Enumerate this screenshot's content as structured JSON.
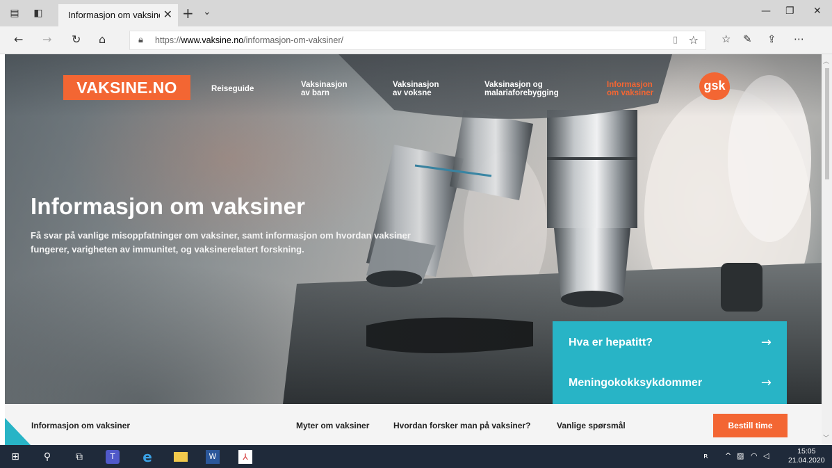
{
  "browser": {
    "tab_title": "Informasjon om vaksine",
    "url_prefix": "https://",
    "url_domain": "www.vaksine.no",
    "url_path": "/informasjon-om-vaksiner/"
  },
  "site": {
    "logo": "VAKSINE.NO",
    "nav": [
      {
        "line1": "Reiseguide",
        "line2": ""
      },
      {
        "line1": "Vaksinasjon",
        "line2": "av barn"
      },
      {
        "line1": "Vaksinasjon",
        "line2": "av voksne"
      },
      {
        "line1": "Vaksinasjon og",
        "line2": "malariaforebygging"
      },
      {
        "line1": "Informasjon",
        "line2": "om vaksiner"
      }
    ],
    "partner_logo": "gsk"
  },
  "hero": {
    "title": "Informasjon om vaksiner",
    "subtitle": "Få svar på vanlige misoppfatninger om vaksiner,  samt informasjon om hvordan vaksiner fungerer, varigheten av immunitet, og vaksinerelatert forskning."
  },
  "cards": [
    {
      "label": "Hva er hepatitt?",
      "arrow": "→"
    },
    {
      "label": "Meningokokksykdommer",
      "arrow": "→"
    }
  ],
  "subnav": {
    "title": "Informasjon om vaksiner",
    "links": [
      "Myter om vaksiner",
      "Hvordan forsker man på vaksiner?",
      "Vanlige spørsmål"
    ],
    "cta": "Bestill time"
  },
  "taskbar": {
    "time": "15:05",
    "date": "21.04.2020"
  },
  "colors": {
    "brand_orange": "#f36633",
    "teal": "#28b4c6"
  }
}
